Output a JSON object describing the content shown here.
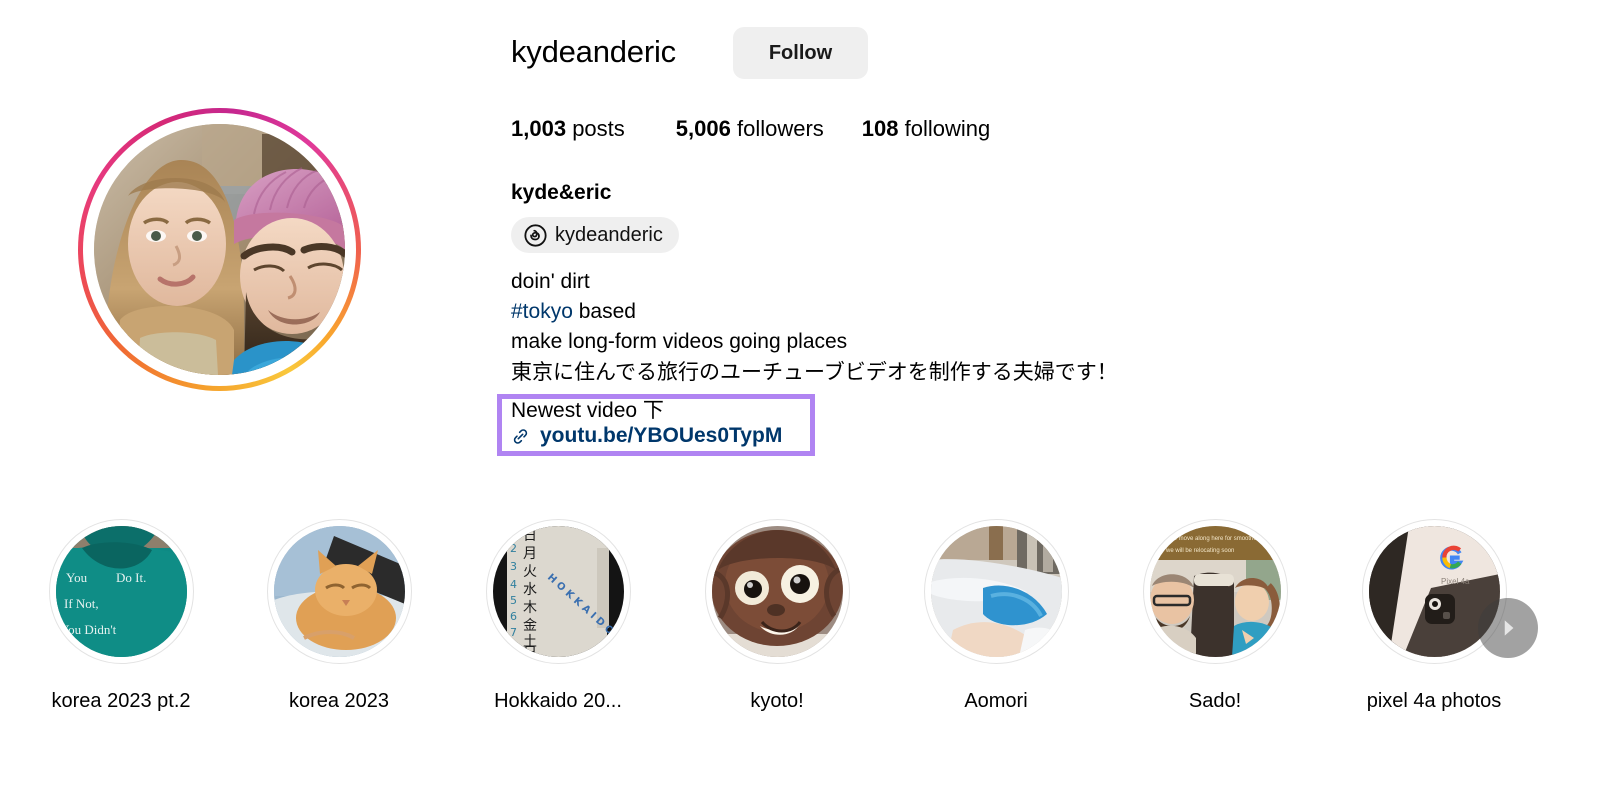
{
  "profile": {
    "username": "kydeanderic",
    "follow_label": "Follow",
    "display_name": "kyde&eric",
    "avatar_alt": "profile-photo-couple-selfie",
    "story_ring_gradient": [
      "#f9c83c",
      "#f06a33",
      "#e6397f",
      "#c5278f"
    ]
  },
  "stats": {
    "posts": {
      "count": "1,003",
      "label": "posts"
    },
    "followers": {
      "count": "5,006",
      "label": "followers"
    },
    "following": {
      "count": "108",
      "label": "following"
    }
  },
  "threads_badge": {
    "icon": "threads-icon",
    "handle": "kydeanderic",
    "background": "#efefef"
  },
  "bio": {
    "line1": "doin' dirt",
    "hashtag": "#tokyo",
    "line2_rest": " based",
    "line3": "make long-form videos going places",
    "line4_jp": "東京に住んでる旅行のユーチューブビデオを制作する夫婦です！",
    "newest_video": "Newest video 下",
    "link_icon": "link-chain-icon",
    "link_text": "youtu.be/YBOUes0TypM",
    "link_color": "#00376b",
    "hashtag_color": "#00376b",
    "highlight_box_color": "#b084f2"
  },
  "highlights": [
    {
      "label": "korea 2023 pt.2",
      "thumb": "teal-hoodie-text-photo"
    },
    {
      "label": "korea 2023",
      "thumb": "orange-cat-photo"
    },
    {
      "label": "Hokkaido 20...",
      "thumb": "whiteboard-hokkaido-photo"
    },
    {
      "label": "kyoto!",
      "thumb": "tanuki-statue-face-photo"
    },
    {
      "label": "Aomori",
      "thumb": "person-sleeping-pillow-photo"
    },
    {
      "label": "Sado!",
      "thumb": "two-people-on-train-photo"
    },
    {
      "label": "pixel 4a photos",
      "thumb": "pixel-4a-box-photo"
    }
  ],
  "next_arrow": {
    "icon": "chevron-right-icon"
  }
}
